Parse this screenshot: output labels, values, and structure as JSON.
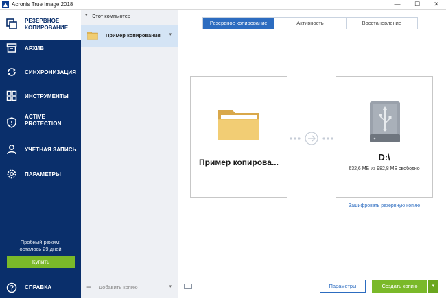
{
  "window": {
    "title": "Acronis True Image 2018",
    "controls": {
      "minimize": "—",
      "maximize": "☐",
      "close": "✕"
    }
  },
  "sidebar": {
    "items": [
      {
        "label_line1": "РЕЗЕРВНОЕ",
        "label_line2": "КОПИРОВАНИЕ",
        "icon": "copy-icon",
        "active": true
      },
      {
        "label_line1": "АРХИВ",
        "label_line2": "",
        "icon": "archive-icon",
        "active": false
      },
      {
        "label_line1": "СИНХРОНИЗАЦИЯ",
        "label_line2": "",
        "icon": "sync-icon",
        "active": false
      },
      {
        "label_line1": "ИНСТРУМЕНТЫ",
        "label_line2": "",
        "icon": "tools-icon",
        "active": false
      },
      {
        "label_line1": "ACTIVE",
        "label_line2": "PROTECTION",
        "icon": "shield-icon",
        "active": false
      },
      {
        "label_line1": "УЧЕТНАЯ ЗАПИСЬ",
        "label_line2": "",
        "icon": "user-icon",
        "active": false
      },
      {
        "label_line1": "ПАРАМЕТРЫ",
        "label_line2": "",
        "icon": "gear-icon",
        "active": false
      }
    ],
    "trial_line1": "Пробный режим:",
    "trial_line2": "осталось 29 дней",
    "buy_label": "Купить",
    "help_label": "СПРАВКА"
  },
  "middle": {
    "computer_label": "Этот компьютер",
    "backup_name": "Пример копирования",
    "add_backup_label": "Добавить копию"
  },
  "main": {
    "tabs": [
      {
        "label": "Резервное копирование",
        "active": true
      },
      {
        "label": "Активность",
        "active": false
      },
      {
        "label": "Восстановление",
        "active": false
      }
    ],
    "source_name": "Пример копирова...",
    "destination_letter": "D:\\",
    "destination_free": "632,6 МБ из 982,8 МБ свободно",
    "encrypt_link": "Зашифровать резервную копию",
    "params_button": "Параметры",
    "create_button": "Создать копию"
  },
  "colors": {
    "sidebar_bg": "#0a2f6b",
    "accent_blue": "#2c6cc0",
    "accent_green": "#7ab929",
    "folder": "#e9c46a"
  }
}
